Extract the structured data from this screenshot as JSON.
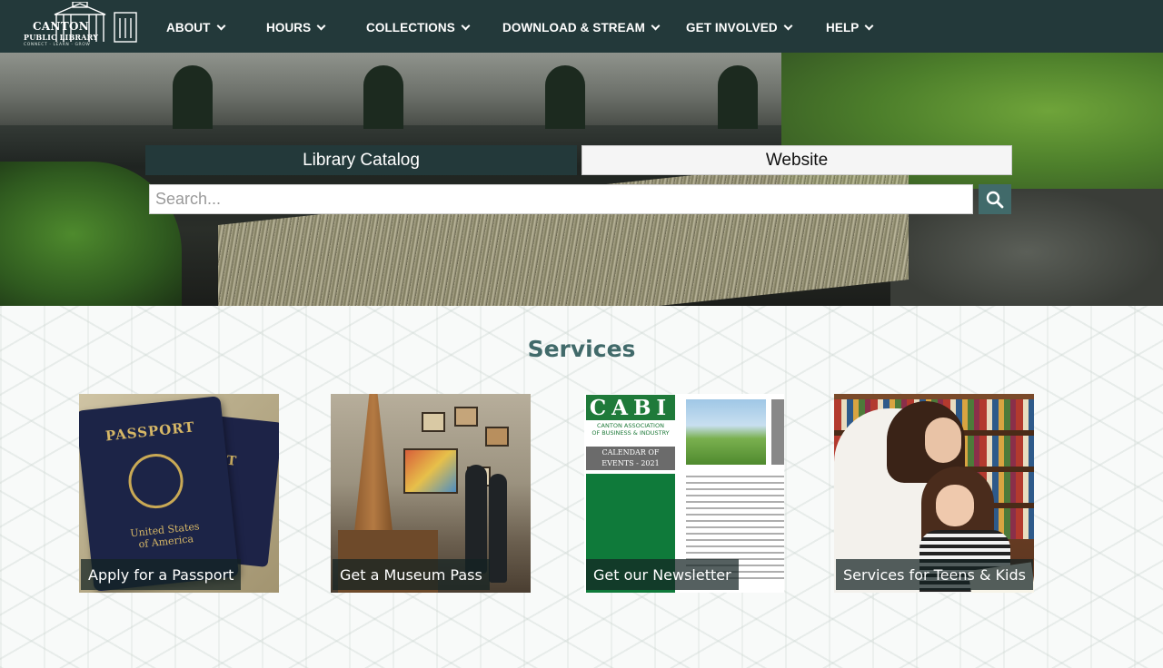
{
  "nav": {
    "logo": {
      "line1": "CANTON",
      "line2": "PUBLIC LIBRARY",
      "tagline": "CONNECT · LEARN · GROW"
    },
    "items": [
      {
        "label": "ABOUT"
      },
      {
        "label": "HOURS"
      },
      {
        "label": "COLLECTIONS"
      },
      {
        "label": "DOWNLOAD & STREAM"
      },
      {
        "label": "GET INVOLVED"
      },
      {
        "label": "HELP"
      }
    ]
  },
  "hero": {
    "tabs": {
      "catalog": "Library Catalog",
      "website": "Website"
    },
    "search": {
      "placeholder": "Search...",
      "value": ""
    }
  },
  "services": {
    "title": "Services",
    "cards": [
      {
        "label": "Apply for a Passport"
      },
      {
        "label": "Get a Museum Pass"
      },
      {
        "label": "Get our Newsletter"
      },
      {
        "label": "Services for Teens & Kids"
      }
    ],
    "passport_art": {
      "front_title": "PASSPORT",
      "back_title": "PORT",
      "country_line1": "United States",
      "country_line2": "of America"
    },
    "newsletter_art": {
      "logo": "CABI",
      "org_line1": "CANTON ASSOCIATION",
      "org_line2": "OF BUSINESS & INDUSTRY",
      "calendar_line1": "CALENDAR OF",
      "calendar_line2": "EVENTS - 2021"
    }
  },
  "colors": {
    "nav_bg": "#23393a",
    "accent": "#416a6a",
    "tab_active_bg": "#23393a",
    "tab_inactive_bg": "#f5f5f5"
  },
  "icons": {
    "search": "magnifier-icon",
    "dropdown": "chevron-down-icon"
  }
}
